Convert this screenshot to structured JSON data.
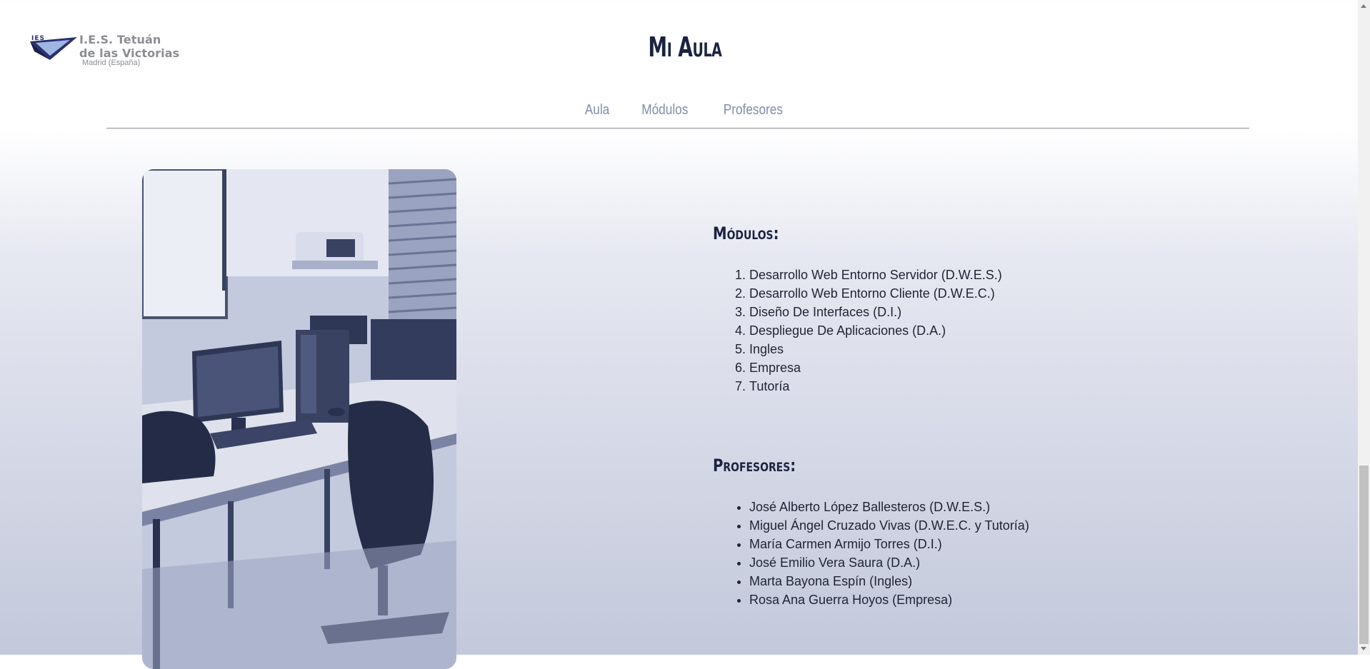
{
  "logo": {
    "abbr": "IES",
    "line1": "I.E.S. Tetuán",
    "line2": "de las Victorias",
    "line3": "Madrid (España)"
  },
  "header": {
    "title": "Mi Aula"
  },
  "nav": {
    "items": [
      "Aula",
      "Módulos",
      "Profesores"
    ]
  },
  "modulos": {
    "heading": "Módulos:",
    "items": [
      "Desarrollo Web Entorno Servidor (D.W.E.S.)",
      "Desarrollo Web Entorno Cliente (D.W.E.C.)",
      "Diseño De Interfaces (D.I.)",
      "Despliegue De Aplicaciones (D.A.)",
      "Ingles",
      "Empresa",
      "Tutoría"
    ]
  },
  "profesores": {
    "heading": "Profesores:",
    "items": [
      "José Alberto López Ballesteros (D.W.E.S.)",
      "Miguel Ángel Cruzado Vivas (D.W.E.C. y Tutoría)",
      "María Carmen Armijo Torres (D.I.)",
      "José Emilio Vera Saura (D.A.)",
      "Marta Bayona Espín (Ingles)",
      "Rosa Ana Guerra Hoyos (Empresa)"
    ]
  },
  "colors": {
    "title": "#1b2340",
    "nav_link": "#7f8dae",
    "photo_tint": "#2b3454"
  }
}
